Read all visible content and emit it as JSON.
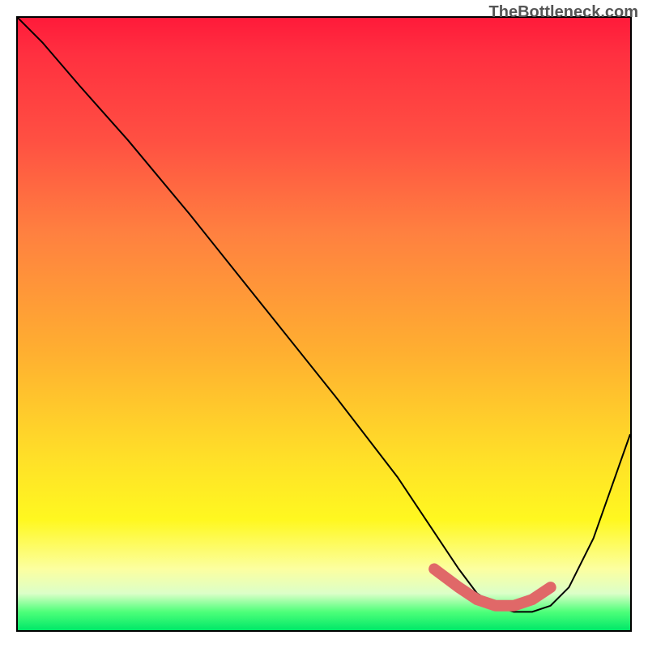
{
  "watermark": "TheBottleneck.com",
  "chart_data": {
    "type": "line",
    "title": "",
    "xlabel": "",
    "ylabel": "",
    "xlim": [
      0,
      100
    ],
    "ylim": [
      0,
      100
    ],
    "series": [
      {
        "name": "bottleneck-curve",
        "x": [
          0,
          4,
          10,
          18,
          28,
          40,
          52,
          62,
          68,
          72,
          75,
          78,
          81,
          84,
          87,
          90,
          94,
          100
        ],
        "values": [
          100,
          96,
          89,
          80,
          68,
          53,
          38,
          25,
          16,
          10,
          6,
          4,
          3,
          3,
          4,
          7,
          15,
          32
        ]
      }
    ],
    "highlight": {
      "name": "optimal-range",
      "x": [
        68,
        72,
        75,
        78,
        81,
        84,
        87
      ],
      "values": [
        10,
        7,
        5,
        4,
        4,
        5,
        7
      ],
      "color": "#e06868"
    }
  }
}
